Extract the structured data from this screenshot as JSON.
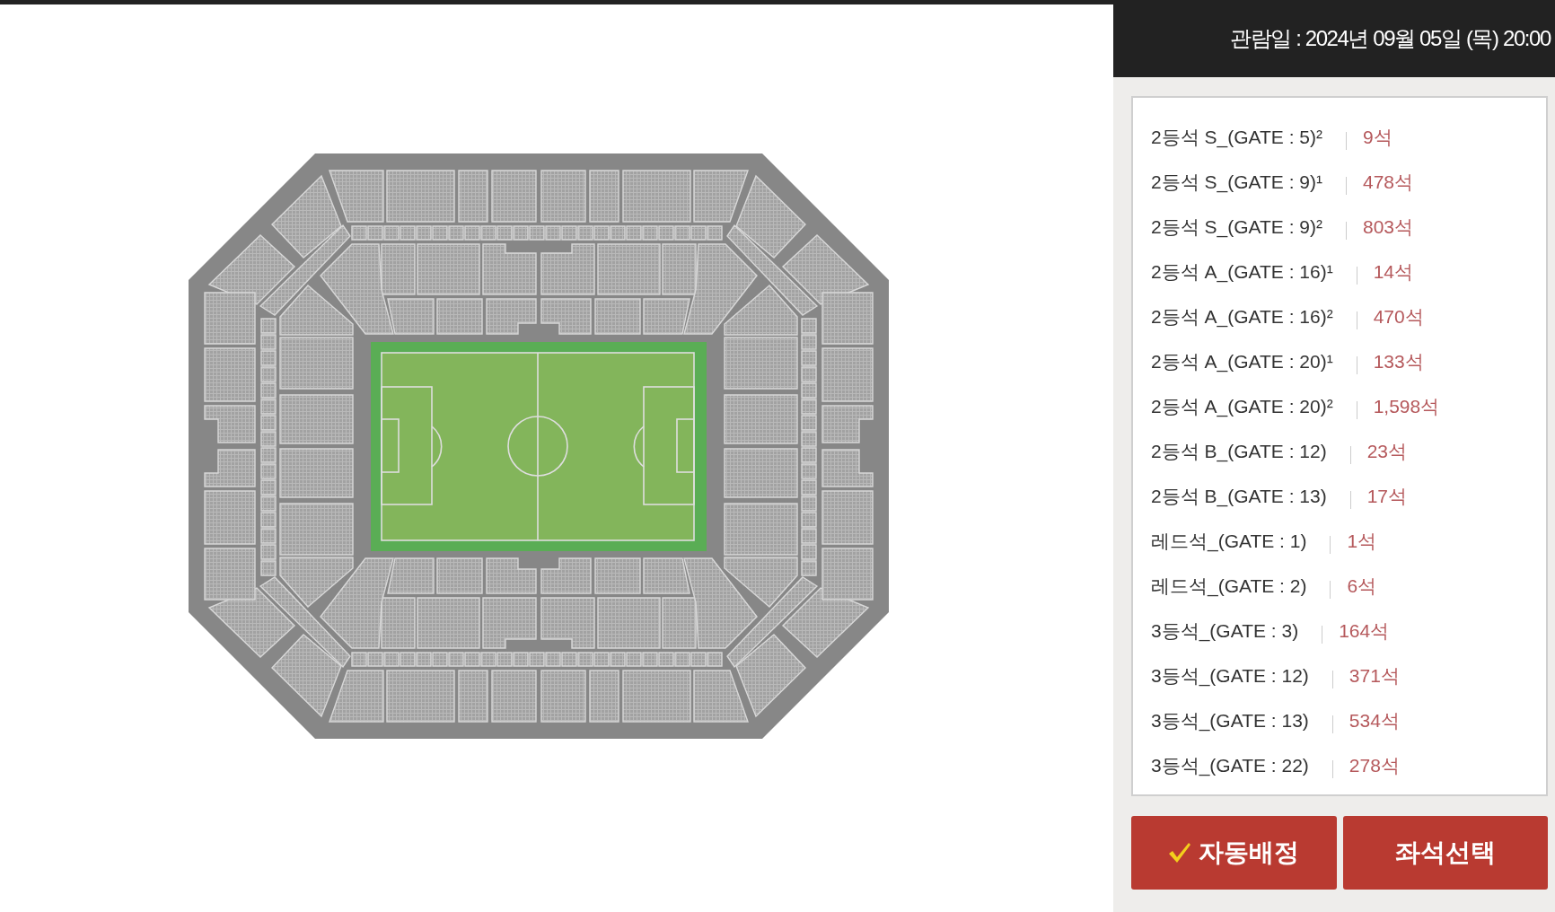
{
  "header": {
    "viewing_date": "관람일 : 2024년 09월 05일 (목) 20:00"
  },
  "seat_grades": [
    {
      "name": "2등석 S_(GATE : 5)²",
      "remaining": "9석"
    },
    {
      "name": "2등석 S_(GATE : 9)¹",
      "remaining": "478석"
    },
    {
      "name": "2등석 S_(GATE : 9)²",
      "remaining": "803석"
    },
    {
      "name": "2등석 A_(GATE : 16)¹",
      "remaining": "14석"
    },
    {
      "name": "2등석 A_(GATE : 16)²",
      "remaining": "470석"
    },
    {
      "name": "2등석 A_(GATE : 20)¹",
      "remaining": "133석"
    },
    {
      "name": "2등석 A_(GATE : 20)²",
      "remaining": "1,598석"
    },
    {
      "name": "2등석 B_(GATE : 12)",
      "remaining": "23석"
    },
    {
      "name": "2등석 B_(GATE : 13)",
      "remaining": "17석"
    },
    {
      "name": "레드석_(GATE : 1)",
      "remaining": "1석"
    },
    {
      "name": "레드석_(GATE : 2)",
      "remaining": "6석"
    },
    {
      "name": "3등석_(GATE : 3)",
      "remaining": "164석"
    },
    {
      "name": "3등석_(GATE : 12)",
      "remaining": "371석"
    },
    {
      "name": "3등석_(GATE : 13)",
      "remaining": "534석"
    },
    {
      "name": "3등석_(GATE : 22)",
      "remaining": "278석"
    }
  ],
  "buttons": [
    {
      "kind": "auto",
      "label": "자동배정"
    },
    {
      "kind": "select",
      "label": "좌석선택"
    }
  ]
}
